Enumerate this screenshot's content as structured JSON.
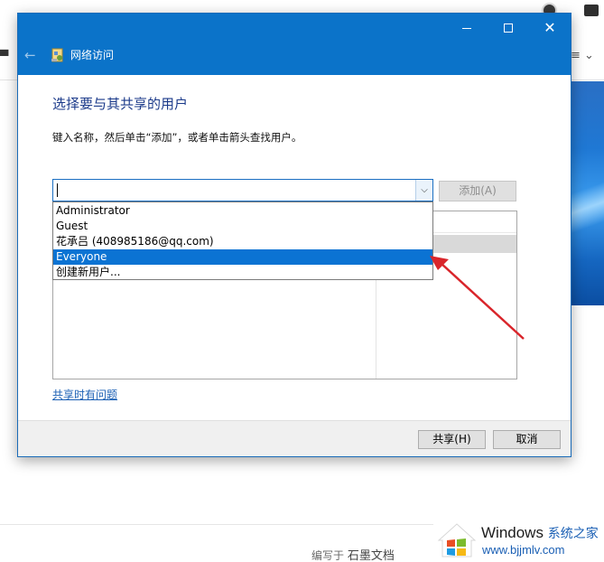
{
  "window": {
    "title": "网络访问",
    "minimize_icon": "minimize-icon",
    "maximize_icon": "maximize-icon",
    "close_icon": "close-icon"
  },
  "page": {
    "heading": "选择要与其共享的用户",
    "instruction": "键入名称，然后单击“添加”，或者单击箭头查找用户。"
  },
  "combo": {
    "value": "",
    "arrow_icon": "chevron-down-icon"
  },
  "add_button": {
    "label": "添加(A)",
    "enabled": false
  },
  "dropdown": {
    "items": [
      {
        "label": "Administrator",
        "selected": false
      },
      {
        "label": "Guest",
        "selected": false
      },
      {
        "label": "花承吕 (408985186@qq.com)",
        "selected": false
      },
      {
        "label": "Everyone",
        "selected": true
      },
      {
        "label": "创建新用户...",
        "selected": false
      }
    ]
  },
  "help_link": "共享时有问题",
  "footer": {
    "share_label": "共享(H)",
    "cancel_label": "取消"
  },
  "background": {
    "footer_text_prefix": "编写于",
    "footer_text_brand": "石墨文档",
    "watermark_title": "Windows",
    "watermark_title_cn": "系统之家",
    "watermark_url": "www.bjjmlv.com"
  },
  "colors": {
    "titlebar": "#0b73c9",
    "selection": "#0b73d3",
    "annotation_arrow": "#d9252b",
    "link": "#1a5fb4"
  }
}
